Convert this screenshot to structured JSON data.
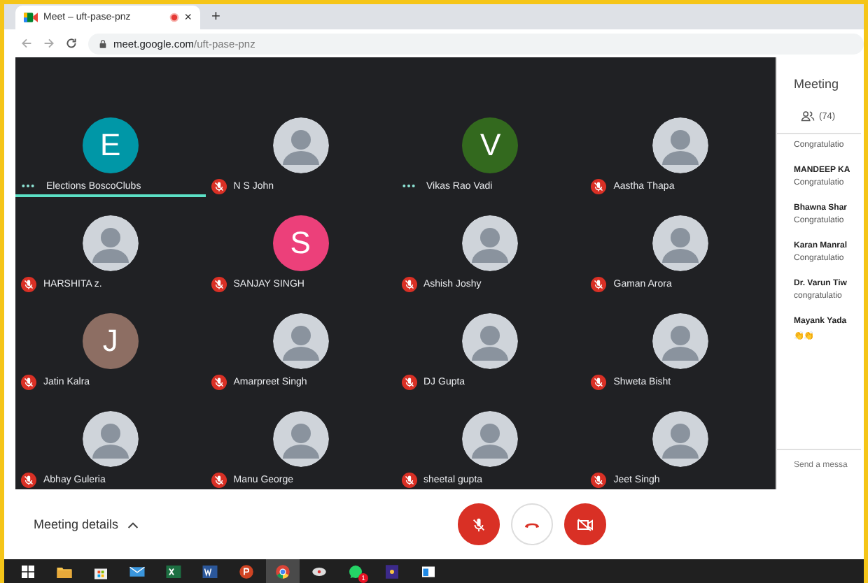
{
  "browser": {
    "tab": {
      "title": "Meet – uft-pase-pnz",
      "recording": true,
      "close": "×"
    },
    "new_tab": "+",
    "url": {
      "host": "meet.google.com",
      "path": "/uft-pase-pnz"
    }
  },
  "participants": [
    {
      "name": "Elections BoscoClubs",
      "kind": "letter",
      "letter": "E",
      "color": "#0097a7",
      "muted": false,
      "speaking": true
    },
    {
      "name": "N S John",
      "kind": "photo",
      "muted": true,
      "speaking": false
    },
    {
      "name": "Vikas Rao Vadi",
      "kind": "letter",
      "letter": "V",
      "color": "#33691e",
      "muted": false,
      "speaking": false
    },
    {
      "name": "Aastha Thapa",
      "kind": "photo",
      "muted": true,
      "speaking": false
    },
    {
      "name": "HARSHITA z.",
      "kind": "photo",
      "muted": true,
      "speaking": false
    },
    {
      "name": "SANJAY SINGH",
      "kind": "letter",
      "letter": "S",
      "color": "#ec407a",
      "muted": true,
      "speaking": false
    },
    {
      "name": "Ashish Joshy",
      "kind": "photo",
      "muted": true,
      "speaking": false
    },
    {
      "name": "Gaman Arora",
      "kind": "photo",
      "muted": true,
      "speaking": false
    },
    {
      "name": "Jatin Kalra",
      "kind": "letter",
      "letter": "J",
      "color": "#8d6e63",
      "muted": true,
      "speaking": false
    },
    {
      "name": "Amarpreet Singh",
      "kind": "photo",
      "muted": true,
      "speaking": false
    },
    {
      "name": "DJ Gupta",
      "kind": "photo",
      "muted": true,
      "speaking": false
    },
    {
      "name": "Shweta Bisht",
      "kind": "photo",
      "muted": true,
      "speaking": false
    },
    {
      "name": "Abhay Guleria",
      "kind": "photo",
      "muted": true,
      "speaking": false
    },
    {
      "name": "Manu George",
      "kind": "photo",
      "muted": true,
      "speaking": false
    },
    {
      "name": "sheetal gupta",
      "kind": "photo",
      "muted": true,
      "speaking": false
    },
    {
      "name": "Jeet Singh",
      "kind": "photo",
      "muted": true,
      "speaking": false
    }
  ],
  "chat": {
    "title": "Meeting",
    "people_count": "(74)",
    "messages": [
      {
        "text": "Congratulatio"
      },
      {
        "sender": "MANDEEP KA",
        "text": "Congratulatio"
      },
      {
        "sender": "Bhawna Shar",
        "text": "Congratulatio"
      },
      {
        "sender": "Karan Manral",
        "text": "Congratulatio"
      },
      {
        "sender": "Dr. Varun Tiw",
        "text": "congratulatio"
      },
      {
        "sender": "Mayank Yada",
        "text": "👏👏"
      }
    ],
    "input": {
      "placeholder": "Send a messa"
    }
  },
  "controls": {
    "meeting_details": "Meeting details",
    "mic_on": false,
    "camera_on": false
  },
  "taskbar": [
    {
      "kind": "windows"
    },
    {
      "kind": "folder"
    },
    {
      "kind": "store"
    },
    {
      "kind": "mail"
    },
    {
      "kind": "excel"
    },
    {
      "kind": "word"
    },
    {
      "kind": "powerpoint"
    },
    {
      "kind": "chrome",
      "selected": true
    },
    {
      "kind": "app"
    },
    {
      "kind": "whatsapp",
      "badge": "1"
    },
    {
      "kind": "media"
    },
    {
      "kind": "window"
    }
  ]
}
